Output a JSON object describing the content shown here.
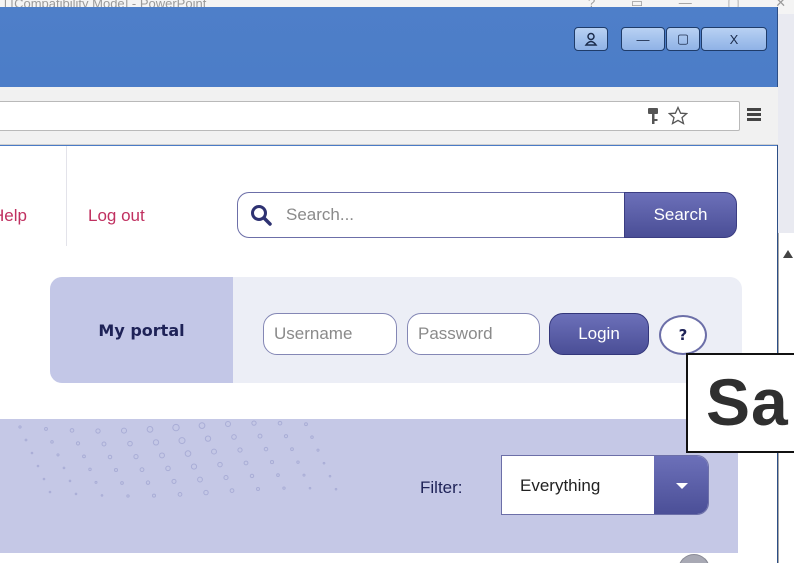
{
  "background_app": {
    "title": "l [Compatibility Mode] - PowerPoint",
    "controls": "? ▭ — ▢ ✕",
    "slide_text": "Sa"
  },
  "window": {
    "buttons": {
      "user": "👤",
      "minimize": "—",
      "maximize": "▢",
      "close": "X"
    }
  },
  "nav": {
    "help": "Help",
    "logout": "Log out"
  },
  "search": {
    "placeholder": "Search...",
    "button": "Search"
  },
  "portal": {
    "title": "My portal",
    "username_placeholder": "Username",
    "password_placeholder": "Password",
    "login_button": "Login",
    "help_button": "?"
  },
  "filter": {
    "label": "Filter:",
    "value": "Everything"
  },
  "colors": {
    "brand": "#4a4e96",
    "link": "#c03060",
    "band": "#c5c8e6"
  }
}
